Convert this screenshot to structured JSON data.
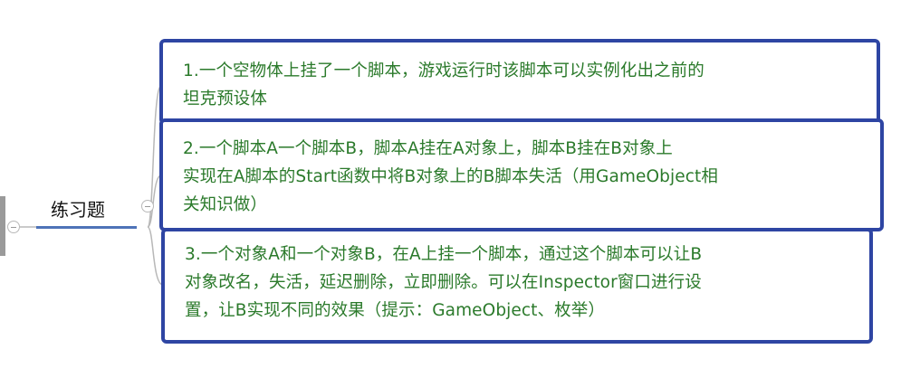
{
  "topic": {
    "label": "练习题"
  },
  "items": [
    {
      "text": "1.一个空物体上挂了一个脚本，游戏运行时该脚本可以实例化出之前的\n坦克预设体"
    },
    {
      "text": "2.一个脚本A一个脚本B，脚本A挂在A对象上，脚本B挂在B对象上\n实现在A脚本的Start函数中将B对象上的B脚本失活（用GameObject相\n关知识做）"
    },
    {
      "text": "3.一个对象A和一个对象B，在A上挂一个脚本，通过这个脚本可以让B\n对象改名，失活，延迟删除，立即删除。可以在Inspector窗口进行设\n置，让B实现不同的效果（提示：GameObject、枚举）"
    }
  ],
  "colors": {
    "card_border": "#2e45a3",
    "card_text": "#2b7a2b",
    "topic_underline": "#4e73b8"
  }
}
